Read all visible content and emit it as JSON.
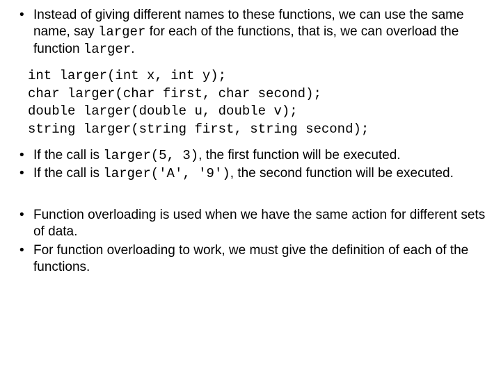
{
  "bullets1": {
    "item1": {
      "t1": "Instead of giving different names to these functions, we can use the same name, say ",
      "code1": "larger",
      "t2": " for each of the functions, that is, we can overload the function ",
      "code2": "larger",
      "t3": "."
    }
  },
  "code": {
    "l1": "int larger(int x, int y);",
    "l2": "char larger(char first, char second);",
    "l3": "double larger(double u, double v);",
    "l4": "string larger(string first, string second);"
  },
  "bullets2": {
    "item1": {
      "t1": "If the call is ",
      "code1": "larger(5, 3)",
      "t2": ", the first function will be executed."
    },
    "item2": {
      "t1": "If the call is ",
      "code1": "larger('A', '9')",
      "t2": ", the second function will be executed."
    }
  },
  "bullets3": {
    "item1": {
      "t1": "Function overloading is used when we have the same action for different sets of data."
    },
    "item2": {
      "t1": "For function overloading to work, we must give the definition of each of the functions."
    }
  }
}
